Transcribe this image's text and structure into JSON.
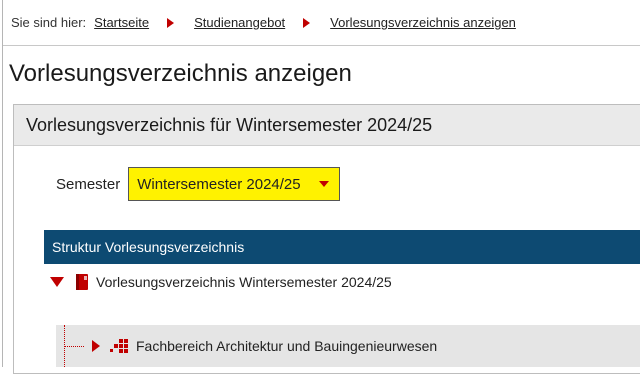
{
  "breadcrumb": {
    "lead": "Sie sind hier:",
    "items": [
      "Startseite",
      "Studienangebot",
      "Vorlesungsverzeichnis anzeigen"
    ]
  },
  "page": {
    "title": "Vorlesungsverzeichnis anzeigen"
  },
  "panel": {
    "header": "Vorlesungsverzeichnis für Wintersemester 2024/25",
    "semester_label": "Semester",
    "semester_value": "Wintersemester 2024/25"
  },
  "tree": {
    "header": "Struktur Vorlesungsverzeichnis",
    "root_label": "Vorlesungsverzeichnis Wintersemester 2024/25",
    "child_label": "Fachbereich Architektur und Bauingenieurwesen"
  },
  "icons": {
    "separator": "chevron-right-icon",
    "dropdown": "chevron-down-icon",
    "expanded": "triangle-down-icon",
    "collapsed": "triangle-right-icon",
    "book": "book-icon",
    "org": "org-unit-icon"
  },
  "colors": {
    "accent_red": "#c00000",
    "highlight_yellow": "#fff200",
    "tree_header_blue": "#0d4a72"
  }
}
